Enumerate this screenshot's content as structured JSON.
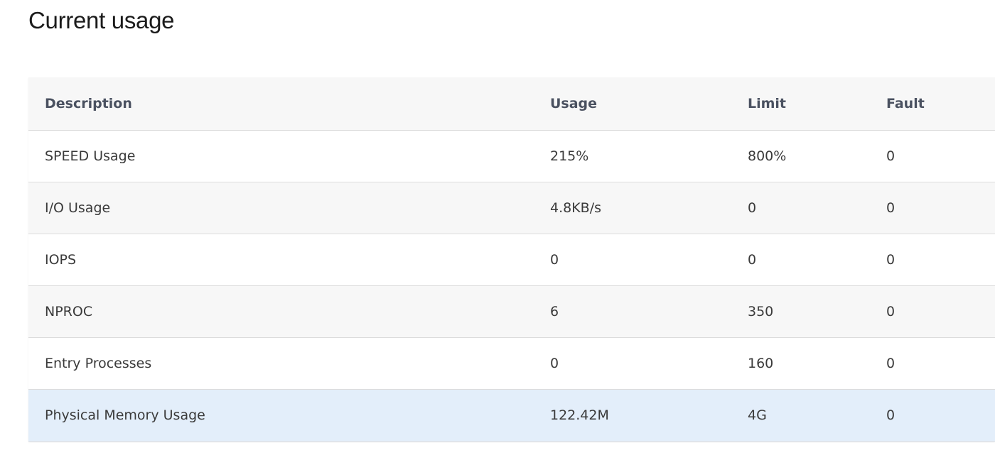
{
  "page": {
    "title": "Current usage"
  },
  "table": {
    "headers": [
      "Description",
      "Usage",
      "Limit",
      "Fault"
    ],
    "rows": [
      {
        "description": "SPEED Usage",
        "usage": "215%",
        "limit": "800%",
        "fault": "0"
      },
      {
        "description": "I/O Usage",
        "usage": "4.8KB/s",
        "limit": "0",
        "fault": "0"
      },
      {
        "description": "IOPS",
        "usage": "0",
        "limit": "0",
        "fault": "0"
      },
      {
        "description": "NPROC",
        "usage": "6",
        "limit": "350",
        "fault": "0"
      },
      {
        "description": "Entry Processes",
        "usage": "0",
        "limit": "160",
        "fault": "0"
      },
      {
        "description": "Physical Memory Usage",
        "usage": "122.42M",
        "limit": "4G",
        "fault": "0"
      }
    ],
    "highlighted_row": 5
  },
  "colors": {
    "header_bg": "#f7f7f7",
    "stripe_bg": "#f7f7f7",
    "highlight_bg": "#e3eefa",
    "header_text": "#4a5160",
    "body_text": "#3a3a3a"
  }
}
